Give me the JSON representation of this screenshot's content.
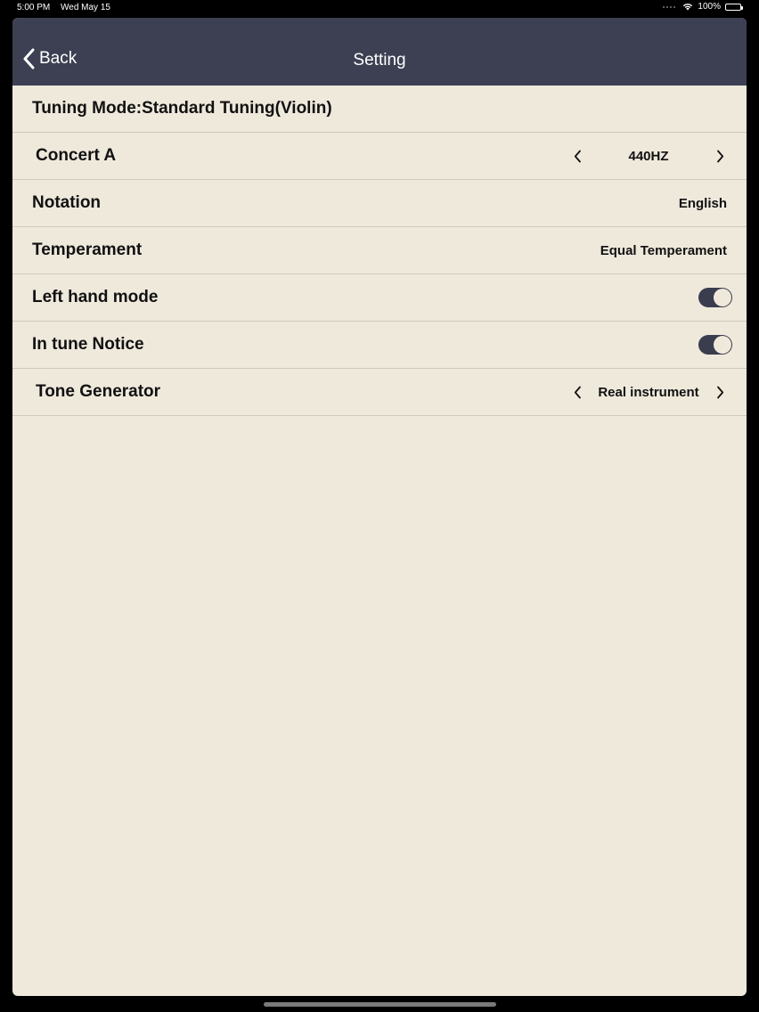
{
  "status_bar": {
    "time": "5:00 PM",
    "date": "Wed May 15",
    "battery": "100%"
  },
  "navbar": {
    "back_label": "Back",
    "title": "Setting"
  },
  "settings": {
    "tuning_mode": "Tuning Mode:Standard Tuning(Violin)",
    "concert_a": {
      "label": "Concert A",
      "value": "440HZ"
    },
    "notation": {
      "label": "Notation",
      "value": "English"
    },
    "temperament": {
      "label": "Temperament",
      "value": "Equal Temperament"
    },
    "left_hand_mode": {
      "label": "Left hand mode",
      "on": true
    },
    "in_tune_notice": {
      "label": "In tune Notice",
      "on": true
    },
    "tone_generator": {
      "label": "Tone Generator",
      "value": "Real instrument"
    }
  },
  "colors": {
    "navbar_bg": "#3c4052",
    "sheet_bg": "#efe9dc",
    "toggle_on": "#3a3d4e",
    "text": "#111111"
  },
  "icons": {
    "back": "chevron-left-icon",
    "decrement": "chevron-left-icon",
    "increment": "chevron-right-icon",
    "wifi": "wifi-icon",
    "battery": "battery-icon"
  }
}
